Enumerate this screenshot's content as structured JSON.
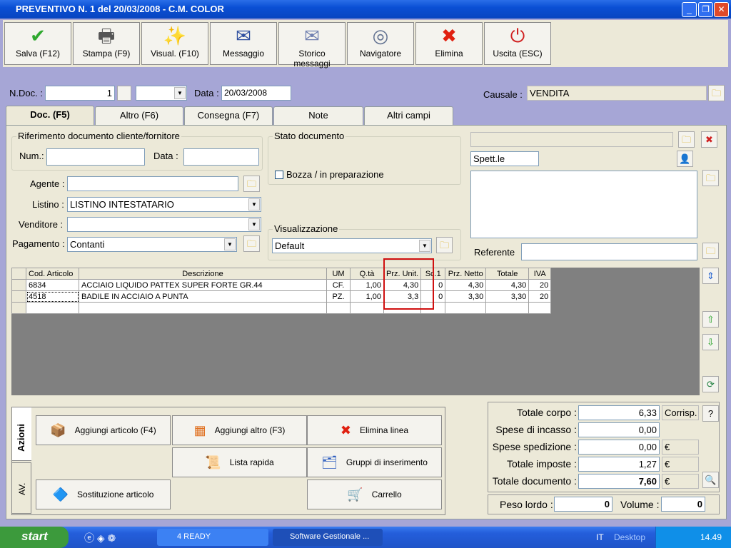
{
  "window": {
    "title": "PREVENTIVO N. 1  del 20/03/2008 - C.M. COLOR"
  },
  "toolbar": [
    {
      "label": "Salva (F12)",
      "icon": "check-icon",
      "sym": "✔",
      "color": "#2ea82e"
    },
    {
      "label": "Stampa (F9)",
      "icon": "printer-icon",
      "sym": "🖶",
      "color": "#555"
    },
    {
      "label": "Visual. (F10)",
      "icon": "magic-wand-icon",
      "sym": "✨",
      "color": "#c08000"
    },
    {
      "label": "Messaggio",
      "icon": "pen-envelope-icon",
      "sym": "✉",
      "color": "#3050a0"
    },
    {
      "label": "Storico messaggi",
      "icon": "envelope-search-icon",
      "sym": "✉",
      "color": "#7080b0"
    },
    {
      "label": "Navigatore",
      "icon": "compass-icon",
      "sym": "◎",
      "color": "#607090"
    },
    {
      "label": "Elimina",
      "icon": "delete-x-icon",
      "sym": "✖",
      "color": "#e02010"
    },
    {
      "label": "Uscita (ESC)",
      "icon": "power-icon",
      "sym": "⏻",
      "color": "#d02020"
    }
  ],
  "header": {
    "ndoc_label": "N.Doc. :",
    "ndoc_value": "1",
    "data_label": "Data :",
    "data_value": "20/03/2008",
    "causale_label": "Causale :",
    "causale_value": "VENDITA"
  },
  "tabs": [
    "Doc. (F5)",
    "Altro (F6)",
    "Consegna (F7)",
    "Note",
    "Altri campi"
  ],
  "riferimento": {
    "title": "Riferimento documento cliente/fornitore",
    "num_label": "Num.:",
    "num_value": "",
    "data_label": "Data :",
    "data_value": ""
  },
  "stato": {
    "title": "Stato documento",
    "bozza_label": "Bozza / in preparazione",
    "bozza_checked": false
  },
  "fields": {
    "agente_label": "Agente :",
    "agente_value": "",
    "listino_label": "Listino :",
    "listino_value": "LISTINO INTESTATARIO",
    "venditore_label": "Venditore :",
    "venditore_value": "",
    "pagamento_label": "Pagamento :",
    "pagamento_value": "Contanti"
  },
  "visualizzazione": {
    "title": "Visualizzazione",
    "value": "Default"
  },
  "cliente": {
    "salutation": "Spett.le",
    "referente_label": "Referente",
    "referente_value": ""
  },
  "table": {
    "columns": [
      "Cod. Articolo",
      "Descrizione",
      "UM",
      "Q.tà",
      "Prz. Unit.",
      "Sc.1",
      "Prz. Netto",
      "Totale",
      "IVA"
    ],
    "rows": [
      [
        "6834",
        "ACCIAIO LIQUIDO PATTEX SUPER FORTE GR.44",
        "CF.",
        "1,00",
        "4,30",
        "0",
        "4,30",
        "4,30",
        "20"
      ],
      [
        "4518",
        "BADILE IN ACCIAIO A PUNTA",
        "PZ.",
        "1,00",
        "3,3",
        "0",
        "3,30",
        "3,30",
        "20"
      ],
      [
        "",
        "",
        "",
        "",
        "",
        "",
        "",
        "",
        ""
      ]
    ],
    "highlight_color": "#d01010"
  },
  "side_tabs": [
    "Azioni",
    "AV."
  ],
  "actions": [
    {
      "label": "Aggiungi articolo (F4)",
      "icon": "add-box-icon",
      "sym": "📦"
    },
    {
      "label": "Aggiungi altro (F3)",
      "icon": "add-grid-icon",
      "sym": "▦"
    },
    {
      "label": "Elimina linea",
      "icon": "delete-x-icon",
      "sym": "✖"
    },
    {
      "label": "Lista rapida",
      "icon": "scroll-add-icon",
      "sym": "📜"
    },
    {
      "label": "Gruppi di inserimento",
      "icon": "group-add-icon",
      "sym": "🗂"
    },
    {
      "label": "Sostituzione articolo",
      "icon": "shapes-icon",
      "sym": "🔷"
    },
    {
      "label": "Carrello",
      "icon": "cart-icon",
      "sym": "🛒"
    }
  ],
  "totals": {
    "corpo_label": "Totale corpo :",
    "corpo": "6,33",
    "corrisp": "Corrisp.",
    "help": "?",
    "incasso_label": "Spese di incasso :",
    "incasso": "0,00",
    "spedizione_label": "Spese spedizione :",
    "spedizione": "0,00",
    "imposte_label": "Totale imposte :",
    "imposte": "1,27",
    "documento_label": "Totale documento :",
    "documento": "7,60",
    "currency": "€",
    "peso_label": "Peso lordo :",
    "peso": "0",
    "volume_label": "Volume :",
    "volume": "0"
  },
  "taskbar": {
    "start": "start",
    "task1": "4 READY",
    "task2": "Software Gestionale ...",
    "lang": "IT",
    "desktop": "Desktop",
    "clock": "14.49"
  }
}
